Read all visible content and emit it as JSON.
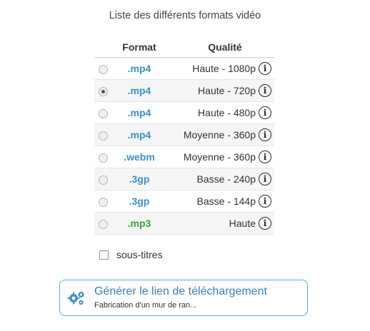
{
  "caption": "Liste des différents formats vidéo",
  "table": {
    "headers": {
      "format": "Format",
      "quality": "Qualité"
    },
    "rows": [
      {
        "format": ".mp4",
        "quality": "Haute - 1080p",
        "selected": false,
        "color": "#3b8fc9"
      },
      {
        "format": ".mp4",
        "quality": "Haute - 720p",
        "selected": true,
        "color": "#3b8fc9"
      },
      {
        "format": ".mp4",
        "quality": "Haute - 480p",
        "selected": false,
        "color": "#3b8fc9"
      },
      {
        "format": ".mp4",
        "quality": "Moyenne - 360p",
        "selected": false,
        "color": "#3b8fc9"
      },
      {
        "format": ".webm",
        "quality": "Moyenne - 360p",
        "selected": false,
        "color": "#3b8fc9"
      },
      {
        "format": ".3gp",
        "quality": "Basse - 240p",
        "selected": false,
        "color": "#3b8fc9"
      },
      {
        "format": ".3gp",
        "quality": "Basse - 144p",
        "selected": false,
        "color": "#3b8fc9"
      },
      {
        "format": ".mp3",
        "quality": "Haute",
        "selected": false,
        "color": "#3aa03a"
      }
    ],
    "info_icon": "info-icon",
    "info_glyph": "i"
  },
  "subtitles": {
    "label": "sous-titres",
    "checked": false
  },
  "generate": {
    "title": "Générer le lien de téléchargement",
    "subtitle": "Fabrication d'un mur de ran...",
    "icon": "gears-icon"
  }
}
